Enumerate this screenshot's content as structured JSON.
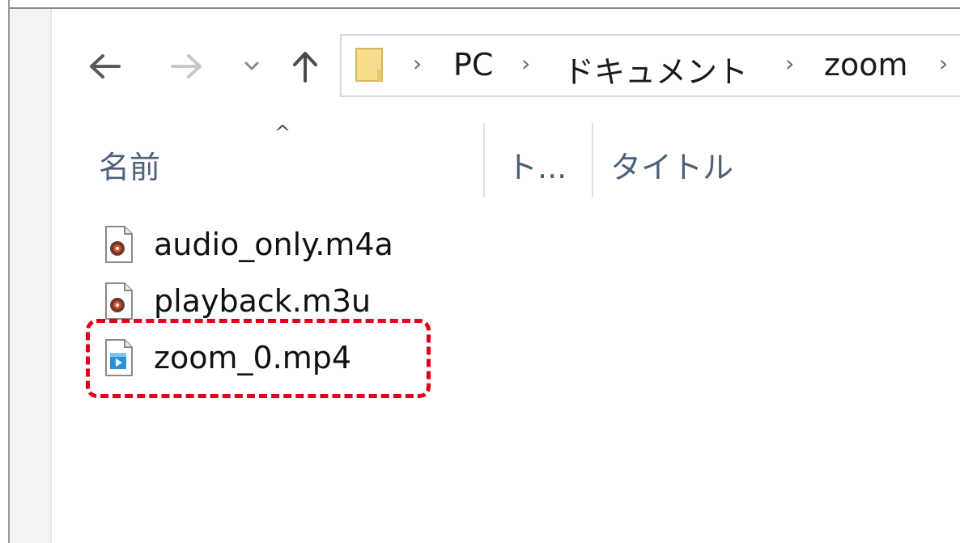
{
  "toolbar": {
    "back_icon": "arrow-left-icon",
    "forward_icon": "arrow-right-icon",
    "recent_icon": "chevron-down-icon",
    "up_icon": "arrow-up-icon"
  },
  "address_bar": {
    "folder_icon": "folder-icon",
    "separator": "›",
    "crumbs": [
      "PC",
      "ドキュメント",
      "zoom"
    ]
  },
  "columns": {
    "sort_indicator": "^",
    "name": "名前",
    "type_truncated": "ト...",
    "title": "タイトル"
  },
  "files": [
    {
      "name": "audio_only.m4a",
      "icon": "audio-file-icon"
    },
    {
      "name": "playback.m3u",
      "icon": "audio-file-icon"
    },
    {
      "name": "zoom_0.mp4",
      "icon": "video-file-icon"
    }
  ],
  "colors": {
    "highlight": "#e0001a",
    "header_text": "#4c607a",
    "folder": "#f4d27a"
  }
}
